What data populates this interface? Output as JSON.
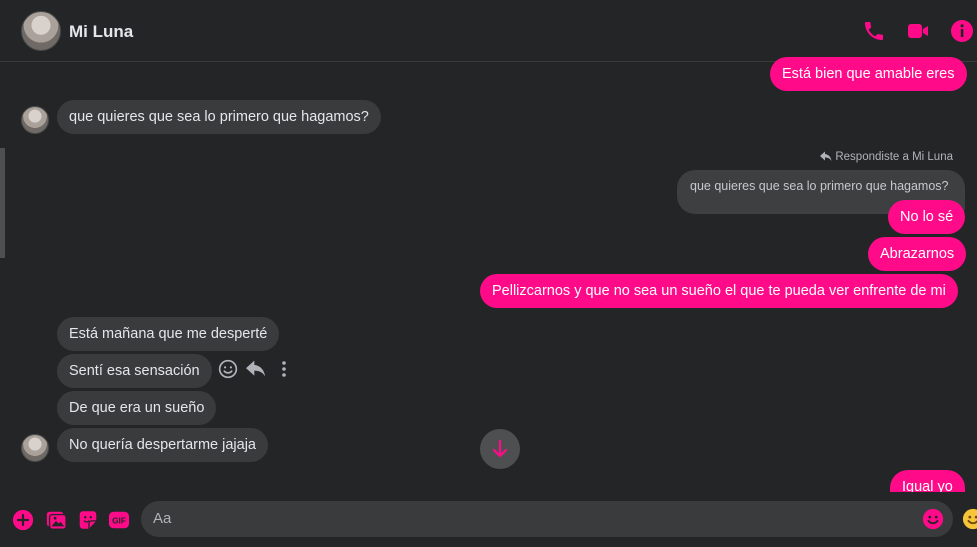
{
  "header": {
    "title": "Mi Luna",
    "icons": [
      "phone-icon",
      "video-camera-icon",
      "info-icon"
    ]
  },
  "colors": {
    "accent": "#ff0b8a",
    "background": "#242526",
    "incoming_bubble": "#3a3b3c"
  },
  "messages": {
    "out_1": "Está bien que amable eres",
    "in_1": "que quieres que sea lo primero que hagamos?",
    "reply_label": "Respondiste a Mi Luna",
    "quoted": "que quieres que sea lo primero que hagamos?",
    "out_2": "No lo sé",
    "out_3": "Abrazarnos",
    "out_4": "Pellizcarnos y que no sea un sueño el que te pueda ver enfrente de mi",
    "in_2": "Está mañana que me desperté",
    "in_3": "Sentí esa sensación",
    "in_4": "De que era un sueño",
    "in_5": "No quería despertarme jajaja",
    "out_5": "Igual yo"
  },
  "composer": {
    "placeholder": "Aa",
    "icons": [
      "plus-icon",
      "photo-icon",
      "sticker-icon",
      "gif-icon",
      "emoji-icon",
      "reaction-icon"
    ],
    "gif_label": "GIF"
  }
}
